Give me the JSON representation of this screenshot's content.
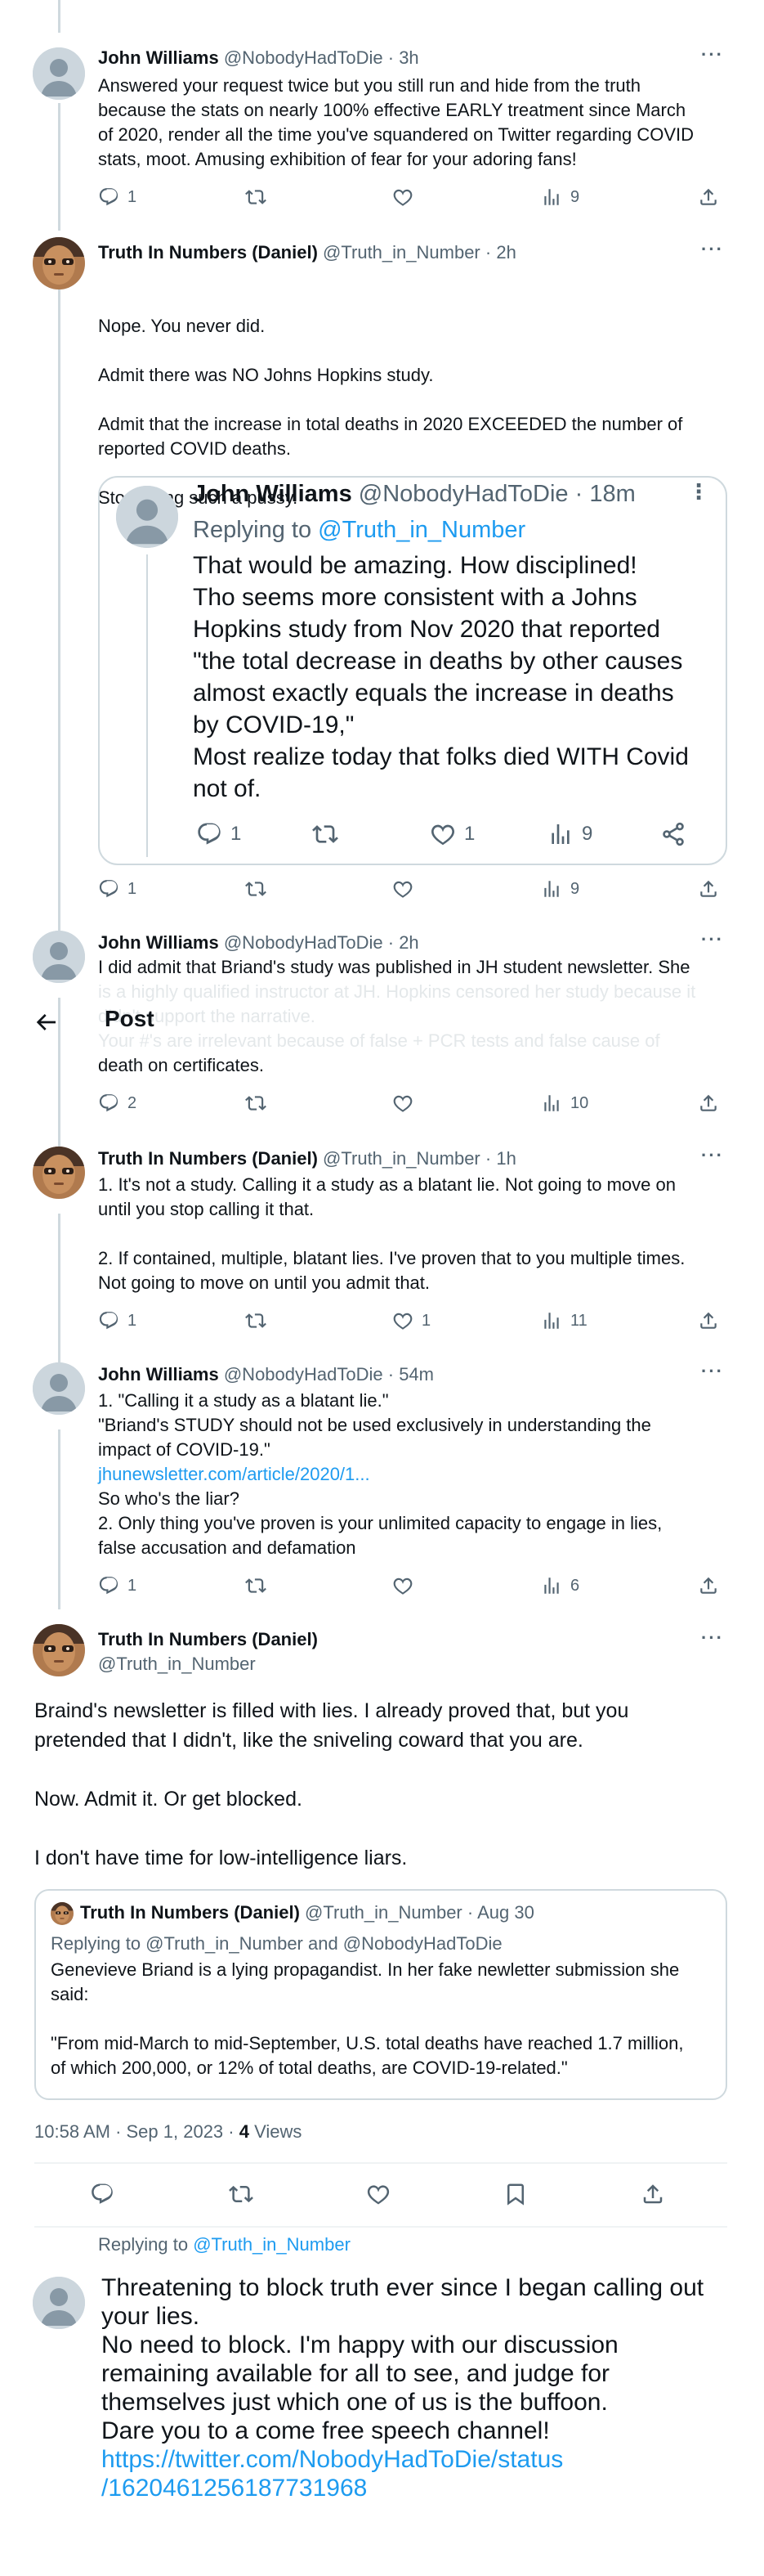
{
  "tweets": [
    {
      "name": "John Williams",
      "handle": "@NobodyHadToDie",
      "sep": " · ",
      "time": "3h",
      "lines": [
        "Answered your request twice but you still run and hide from the truth",
        "because the stats on nearly 100% effective EARLY treatment since March",
        "of 2020, render all the time you've squandered on Twitter regarding COVID",
        "stats, moot. Amusing exhibition of fear for your adoring fans!"
      ],
      "replies": "1",
      "retweets": "",
      "likes": "",
      "views": "9"
    },
    {
      "name": "Truth In Numbers (Daniel)",
      "handle": "@Truth_in_Number",
      "sep": " · ",
      "time": "2h",
      "p1": "Nope. You never did.",
      "p2a": "Admit there was NO Johns Hopkins study.",
      "p3a": "Admit that the increase in total deaths in 2020 EXCEEDED the number of",
      "p3b": "reported COVID deaths.",
      "p4": "Stop being such a pussy.",
      "replies": "1",
      "retweets": "",
      "likes": "",
      "views": "9"
    },
    {
      "name": "John Williams",
      "handle": "@NobodyHadToDie",
      "sep": " · ",
      "time": "2h",
      "line1": "I did admit that Briand's study was published in JH student newsletter. She",
      "line2_faded": "is a highly qualified instructor at JH. Hopkins censored her study because it",
      "line3_faded": "didn't support the narrative.",
      "line4_faded_a": "Your #'s are irrelevant because of false + PCR tests and false cause of",
      "line5": "death on certificates.",
      "replies": "2",
      "retweets": "",
      "likes": "",
      "views": "10"
    },
    {
      "name": "Truth In Numbers (Daniel)",
      "handle": "@Truth_in_Number",
      "sep": " · ",
      "time": "1h",
      "l1": "1. It's not a study. Calling it a study as a blatant lie. Not going to move on",
      "l2": "until you stop calling it that.",
      "l3": "2. If contained, multiple, blatant lies. I've proven that to you multiple times.",
      "l4": "Not going to move on until you admit that.",
      "replies": "1",
      "retweets": "",
      "likes": "1",
      "views": "11"
    },
    {
      "name": "John Williams",
      "handle": "@NobodyHadToDie",
      "sep": " · ",
      "time": "54m",
      "l1": "1. \"Calling it a study as a blatant lie.\"",
      "l2": "\"Briand's STUDY should not be used exclusively in understanding the",
      "l3": "impact of COVID-19.\"",
      "l4_link": "jhunewsletter.com/article/2020/1...",
      "l5": "So who's the liar?",
      "l6": "2. Only thing you've proven is your unlimited capacity to engage in lies,",
      "l7": "false accusation and defamation",
      "replies": "1",
      "retweets": "",
      "likes": "",
      "views": "6"
    }
  ],
  "quoted": {
    "name": "John Williams",
    "handle": "@NobodyHadToDie",
    "sep": " · ",
    "time": "18m",
    "replying_prefix": "Replying to ",
    "replying_handle": "@Truth_in_Number",
    "lines": [
      "That would be amazing. How disciplined!",
      "Tho seems more consistent with a Johns",
      "Hopkins study from Nov 2020 that reported",
      "\"the total decrease in deaths by other causes",
      "almost exactly equals the increase in deaths",
      "by COVID-19,\"",
      "Most realize today that folks died WITH Covid",
      "not of."
    ],
    "replies": "1",
    "likes": "1",
    "views": "9"
  },
  "topbar": {
    "title": "Post"
  },
  "main_tweet": {
    "name": "Truth In Numbers (Daniel)",
    "handle": "@Truth_in_Number",
    "p1a": "Braind's newsletter is filled with lies. I already proved that, but you",
    "p1b": "pretended that I didn't, like the sniveling coward that you are.",
    "p2": "Now. Admit it. Or get blocked.",
    "p3": "I don't have time for low-intelligence liars.",
    "quote": {
      "name": "Truth In Numbers (Daniel)",
      "handle": "@Truth_in_Number",
      "sep": " · ",
      "date": "Aug 30",
      "replying": "Replying to @Truth_in_Number and @NobodyHadToDie",
      "l1": "Genevieve Briand is a lying propagandist. In her fake newletter submission she",
      "l2": "said:",
      "l3": "\"From mid-March to mid-September, U.S. total deaths have reached 1.7 million,",
      "l4": "of which 200,000, or 12% of total deaths, are COVID-19-related.\""
    },
    "timestamp": "10:58 AM · Sep 1, 2023 · ",
    "views_count": "4",
    "views_label": " Views"
  },
  "reply_compose": {
    "replying_prefix": "Replying to ",
    "replying_handle": "@Truth_in_Number",
    "lines": [
      "Threatening to block truth ever since I began calling out",
      "your lies.",
      "No need to block. I'm happy with our discussion",
      "remaining available for all to see, and judge for",
      "themselves just which one of us is the buffoon.",
      "Dare you to a come free speech channel!"
    ],
    "link1": "https://twitter.com/NobodyHadToDie/status",
    "link2": "/1620461256187731968"
  },
  "colors": {
    "accent": "#1d9bf0",
    "muted": "#536471",
    "border": "#cfd9de"
  }
}
